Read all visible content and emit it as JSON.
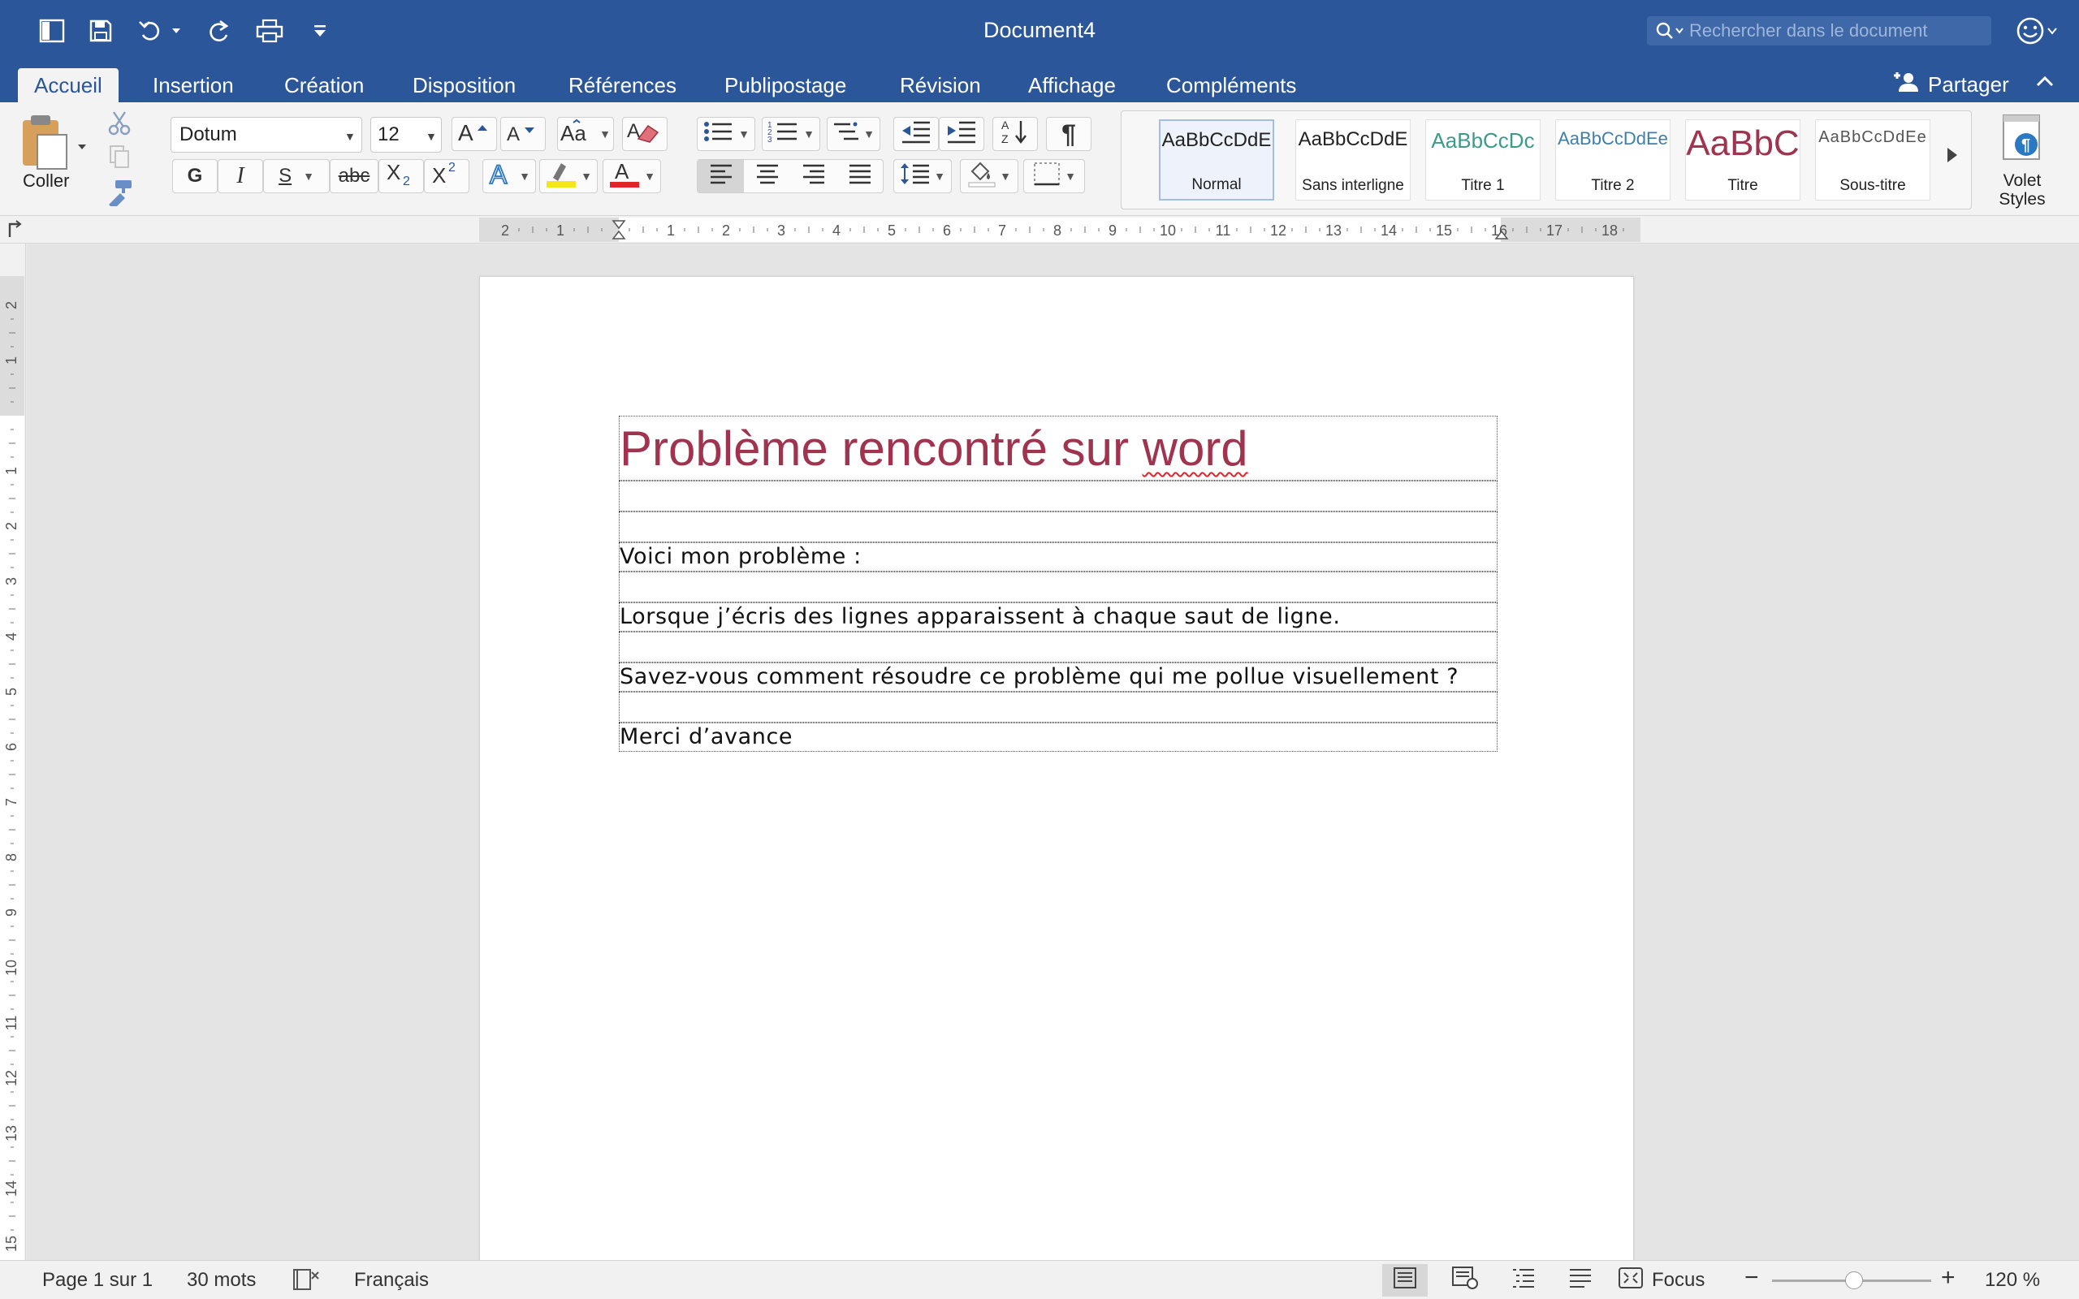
{
  "window": {
    "title": "Document4"
  },
  "search": {
    "placeholder": "Rechercher dans le document"
  },
  "tabs": [
    "Accueil",
    "Insertion",
    "Création",
    "Disposition",
    "Références",
    "Publipostage",
    "Révision",
    "Affichage",
    "Compléments"
  ],
  "active_tab": "Accueil",
  "share_label": "Partager",
  "ribbon": {
    "paste_label": "Coller",
    "font_name": "Dotum",
    "font_size": "12",
    "bold_label": "G",
    "italic_label": "I",
    "underline_label": "S",
    "strike_label": "abc",
    "pilcrow": "¶",
    "styles": [
      {
        "sample": "AaBbCcDdE",
        "name": "Normal",
        "color": "#222222"
      },
      {
        "sample": "AaBbCcDdE",
        "name": "Sans interligne",
        "color": "#222222"
      },
      {
        "sample": "AaBbCcDc",
        "name": "Titre 1",
        "color": "#3d9a8b"
      },
      {
        "sample": "AaBbCcDdEe",
        "name": "Titre 2",
        "color": "#3d7fa6"
      },
      {
        "sample": "AaBbC",
        "name": "Titre",
        "color": "#a0344f"
      },
      {
        "sample": "AaBbCcDdEe",
        "name": "Sous-titre",
        "color": "#555555"
      }
    ],
    "styles_pane_label_1": "Volet",
    "styles_pane_label_2": "Styles"
  },
  "hruler": {
    "labels": [
      "2",
      "1",
      "",
      "1",
      "2",
      "3",
      "4",
      "5",
      "6",
      "7",
      "8",
      "9",
      "10",
      "11",
      "12",
      "13",
      "14",
      "15",
      "16",
      "17",
      "18"
    ]
  },
  "vruler": {
    "labels": [
      "2",
      "1",
      "",
      "1",
      "2",
      "3",
      "4",
      "5",
      "6",
      "7",
      "8",
      "9",
      "10",
      "11",
      "12",
      "13",
      "14",
      "15"
    ]
  },
  "document": {
    "heading_part1": "Problème rencontré sur ",
    "heading_part2": "word",
    "paragraphs": [
      "",
      "",
      "Voici mon problème :",
      "",
      "Lorsque j’écris des lignes apparaissent à chaque saut de ligne.",
      "",
      "Savez-vous comment résoudre ce problème qui me pollue visuellement ?",
      "",
      "Merci d’avance"
    ]
  },
  "status": {
    "page": "Page 1 sur 1",
    "words": "30 mots",
    "language": "Français",
    "focus": "Focus",
    "zoom": "120 %"
  },
  "colors": {
    "accent": "#2b579a",
    "heading": "#a0344f",
    "spell_error": "#e0242a"
  }
}
